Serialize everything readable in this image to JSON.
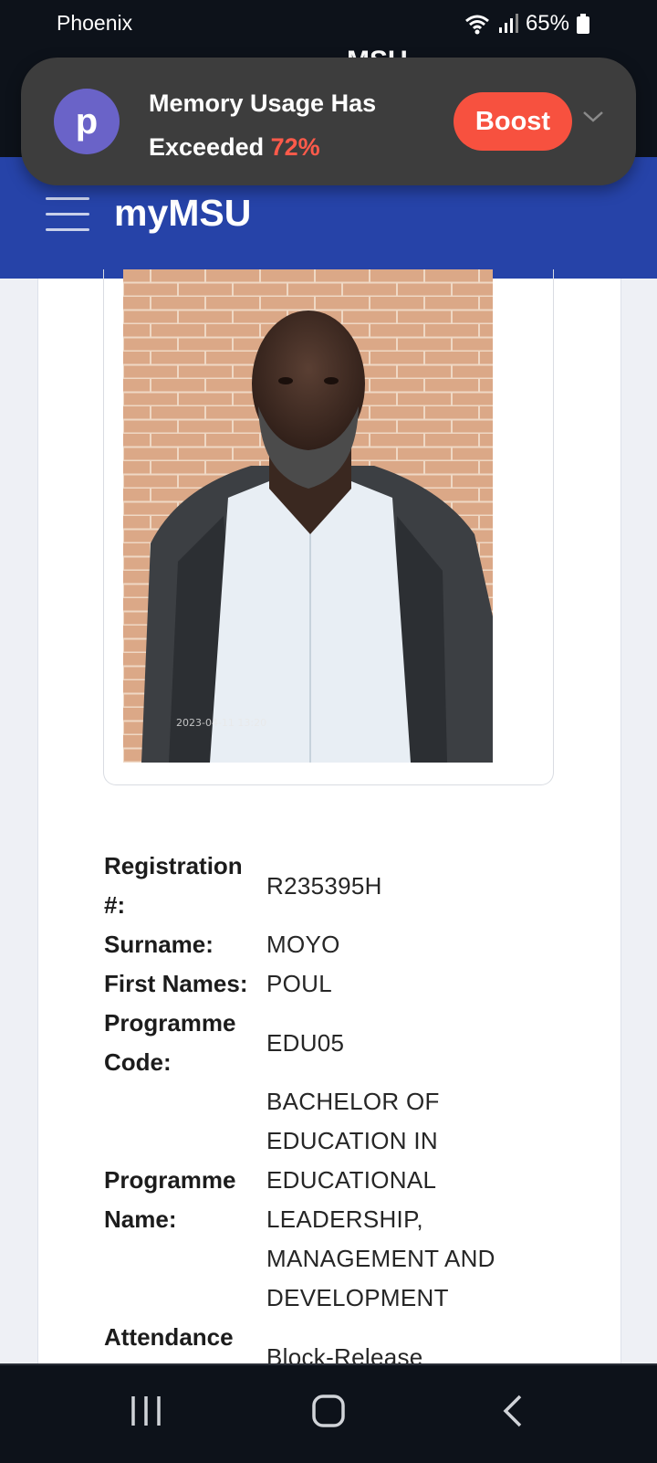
{
  "status_bar": {
    "carrier": "Phoenix",
    "battery": "65%",
    "icons": [
      "wifi-icon",
      "signal-icon",
      "battery-icon"
    ]
  },
  "notification": {
    "app_letter": "p",
    "line1": "Memory Usage Has",
    "line2": "Exceeded",
    "percent": "72%",
    "button": "Boost"
  },
  "app_bar": {
    "background_title": "MSU",
    "title": "myMSU"
  },
  "student": {
    "fields": [
      {
        "label": "Registration #:",
        "value": "R235395H"
      },
      {
        "label": "Surname:",
        "value": "MOYO"
      },
      {
        "label": "First Names:",
        "value": "POUL"
      },
      {
        "label": "Programme Code:",
        "value": "EDU05"
      },
      {
        "label": "Programme Name:",
        "value": "BACHELOR OF EDUCATION IN EDUCATIONAL LEADERSHIP, MANAGEMENT AND DEVELOPMENT"
      },
      {
        "label": "Attendance Type:",
        "value": "Block-Release"
      }
    ],
    "photo_caption": "2023-04-11 13:20"
  },
  "colors": {
    "app_bar": "#2643a8",
    "boost": "#f7513f",
    "notification_bg": "#3d3d3d"
  }
}
